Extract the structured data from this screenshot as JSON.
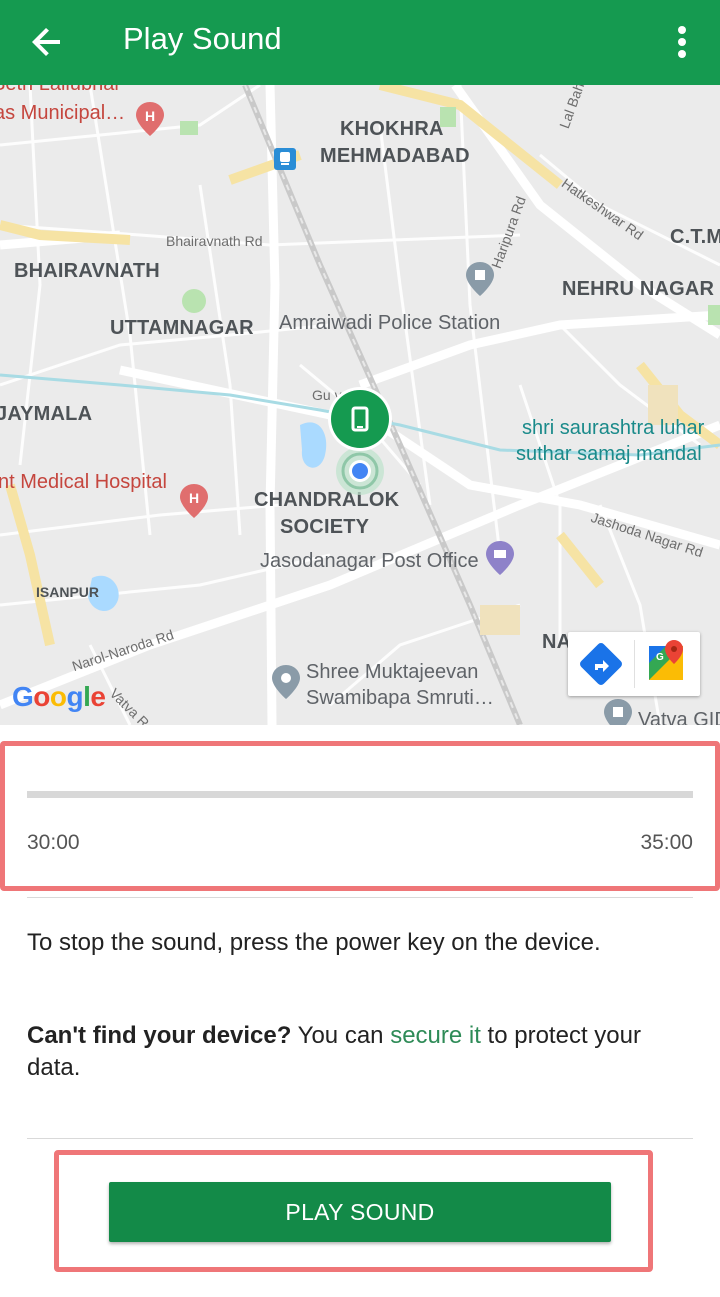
{
  "appbar": {
    "title": "Play Sound",
    "back_icon": "arrow-left-icon",
    "more_icon": "more-vert-icon",
    "color": "#159a50"
  },
  "map": {
    "labels": {
      "lallubhai": "Seth Lallubhai",
      "municipal": "as Municipal…",
      "khokhra": "KHOKHRA",
      "mehmadabad": "MEHMADABAD",
      "lal_bahadur": "Lal Bah",
      "hatkeshwar": "Hatkeshwar Rd",
      "ctm": "C.T.M",
      "haripura": "Haripura Rd",
      "bhairavnath_rd": "Bhairavnath Rd",
      "bhairavnath": "BHAIRAVNATH",
      "nehru_nagar": "NEHRU NAGAR",
      "uttamnagar": "UTTAMNAGAR",
      "amraiwadi": "Amraiwadi Police Station",
      "jaymala": "JAYMALA",
      "guj_river": "Gu      ver",
      "shri_1": "shri saurashtra luhar",
      "shri_2": "suthar samaj mandal",
      "hospital": "nt Medical Hospital",
      "chandralok_1": "CHANDRALOK",
      "chandralok_2": "SOCIETY",
      "jashoda": "Jashoda Nagar Rd",
      "jasodanagar_po": "Jasodanagar Post Office",
      "isanpur": "ISANPUR",
      "narol": "Narol-Naroda Rd",
      "navi": "NAVI VASAHAT",
      "shree_1": "Shree Muktajeevan",
      "shree_2": "Swamibapa Smruti…",
      "vatva_rd": "Vatva R",
      "vatva_gid": "Vatva GID"
    },
    "google_logo": [
      "G",
      "o",
      "o",
      "g",
      "l",
      "e"
    ],
    "device_marker_icon": "phone-icon",
    "directions_icon": "directions-icon",
    "maps_icon": "google-maps-icon"
  },
  "timer": {
    "elapsed": "30:00",
    "total": "35:00",
    "progress_fraction": 0,
    "accent": "#159a50"
  },
  "instructions": {
    "stop": "To stop the sound, press the power key on the device.",
    "cant_find_bold": "Can't find your device?",
    "cant_find_pre": " You can ",
    "secure_link": "secure it",
    "cant_find_post": " to protect your data."
  },
  "button": {
    "play_label": "PLAY SOUND",
    "color": "#138a48"
  }
}
